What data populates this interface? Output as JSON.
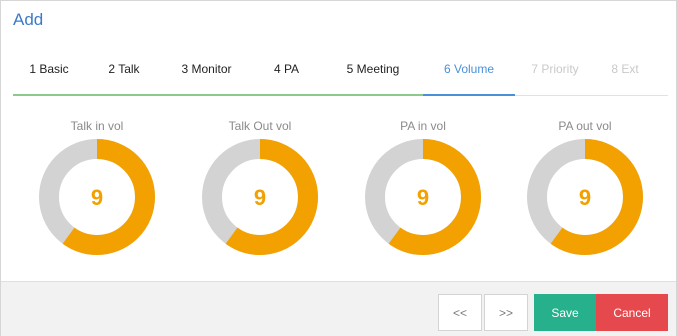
{
  "dialog": {
    "title": "Add"
  },
  "tabs": [
    {
      "label": "1 Basic",
      "state": "done"
    },
    {
      "label": "2 Talk",
      "state": "done"
    },
    {
      "label": "3 Monitor",
      "state": "done"
    },
    {
      "label": "4 PA",
      "state": "done"
    },
    {
      "label": "5 Meeting",
      "state": "done"
    },
    {
      "label": "6 Volume",
      "state": "active"
    },
    {
      "label": "7 Priority",
      "state": "disabled"
    },
    {
      "label": "8 Ext",
      "state": "disabled"
    }
  ],
  "gauges": [
    {
      "label": "Talk in vol",
      "value": "9",
      "max": 15
    },
    {
      "label": "Talk Out vol",
      "value": "9",
      "max": 15
    },
    {
      "label": "PA in vol",
      "value": "9",
      "max": 15
    },
    {
      "label": "PA out vol",
      "value": "9",
      "max": 15
    }
  ],
  "footer": {
    "prev_label": "<<",
    "next_label": ">>",
    "save_label": "Save",
    "cancel_label": "Cancel"
  },
  "colors": {
    "accent": "#4a90d9",
    "gauge_fill": "#f2a100",
    "gauge_track": "#d3d3d3",
    "save": "#26b08c",
    "cancel": "#e5494d",
    "tab_done": "#8cc98c"
  }
}
